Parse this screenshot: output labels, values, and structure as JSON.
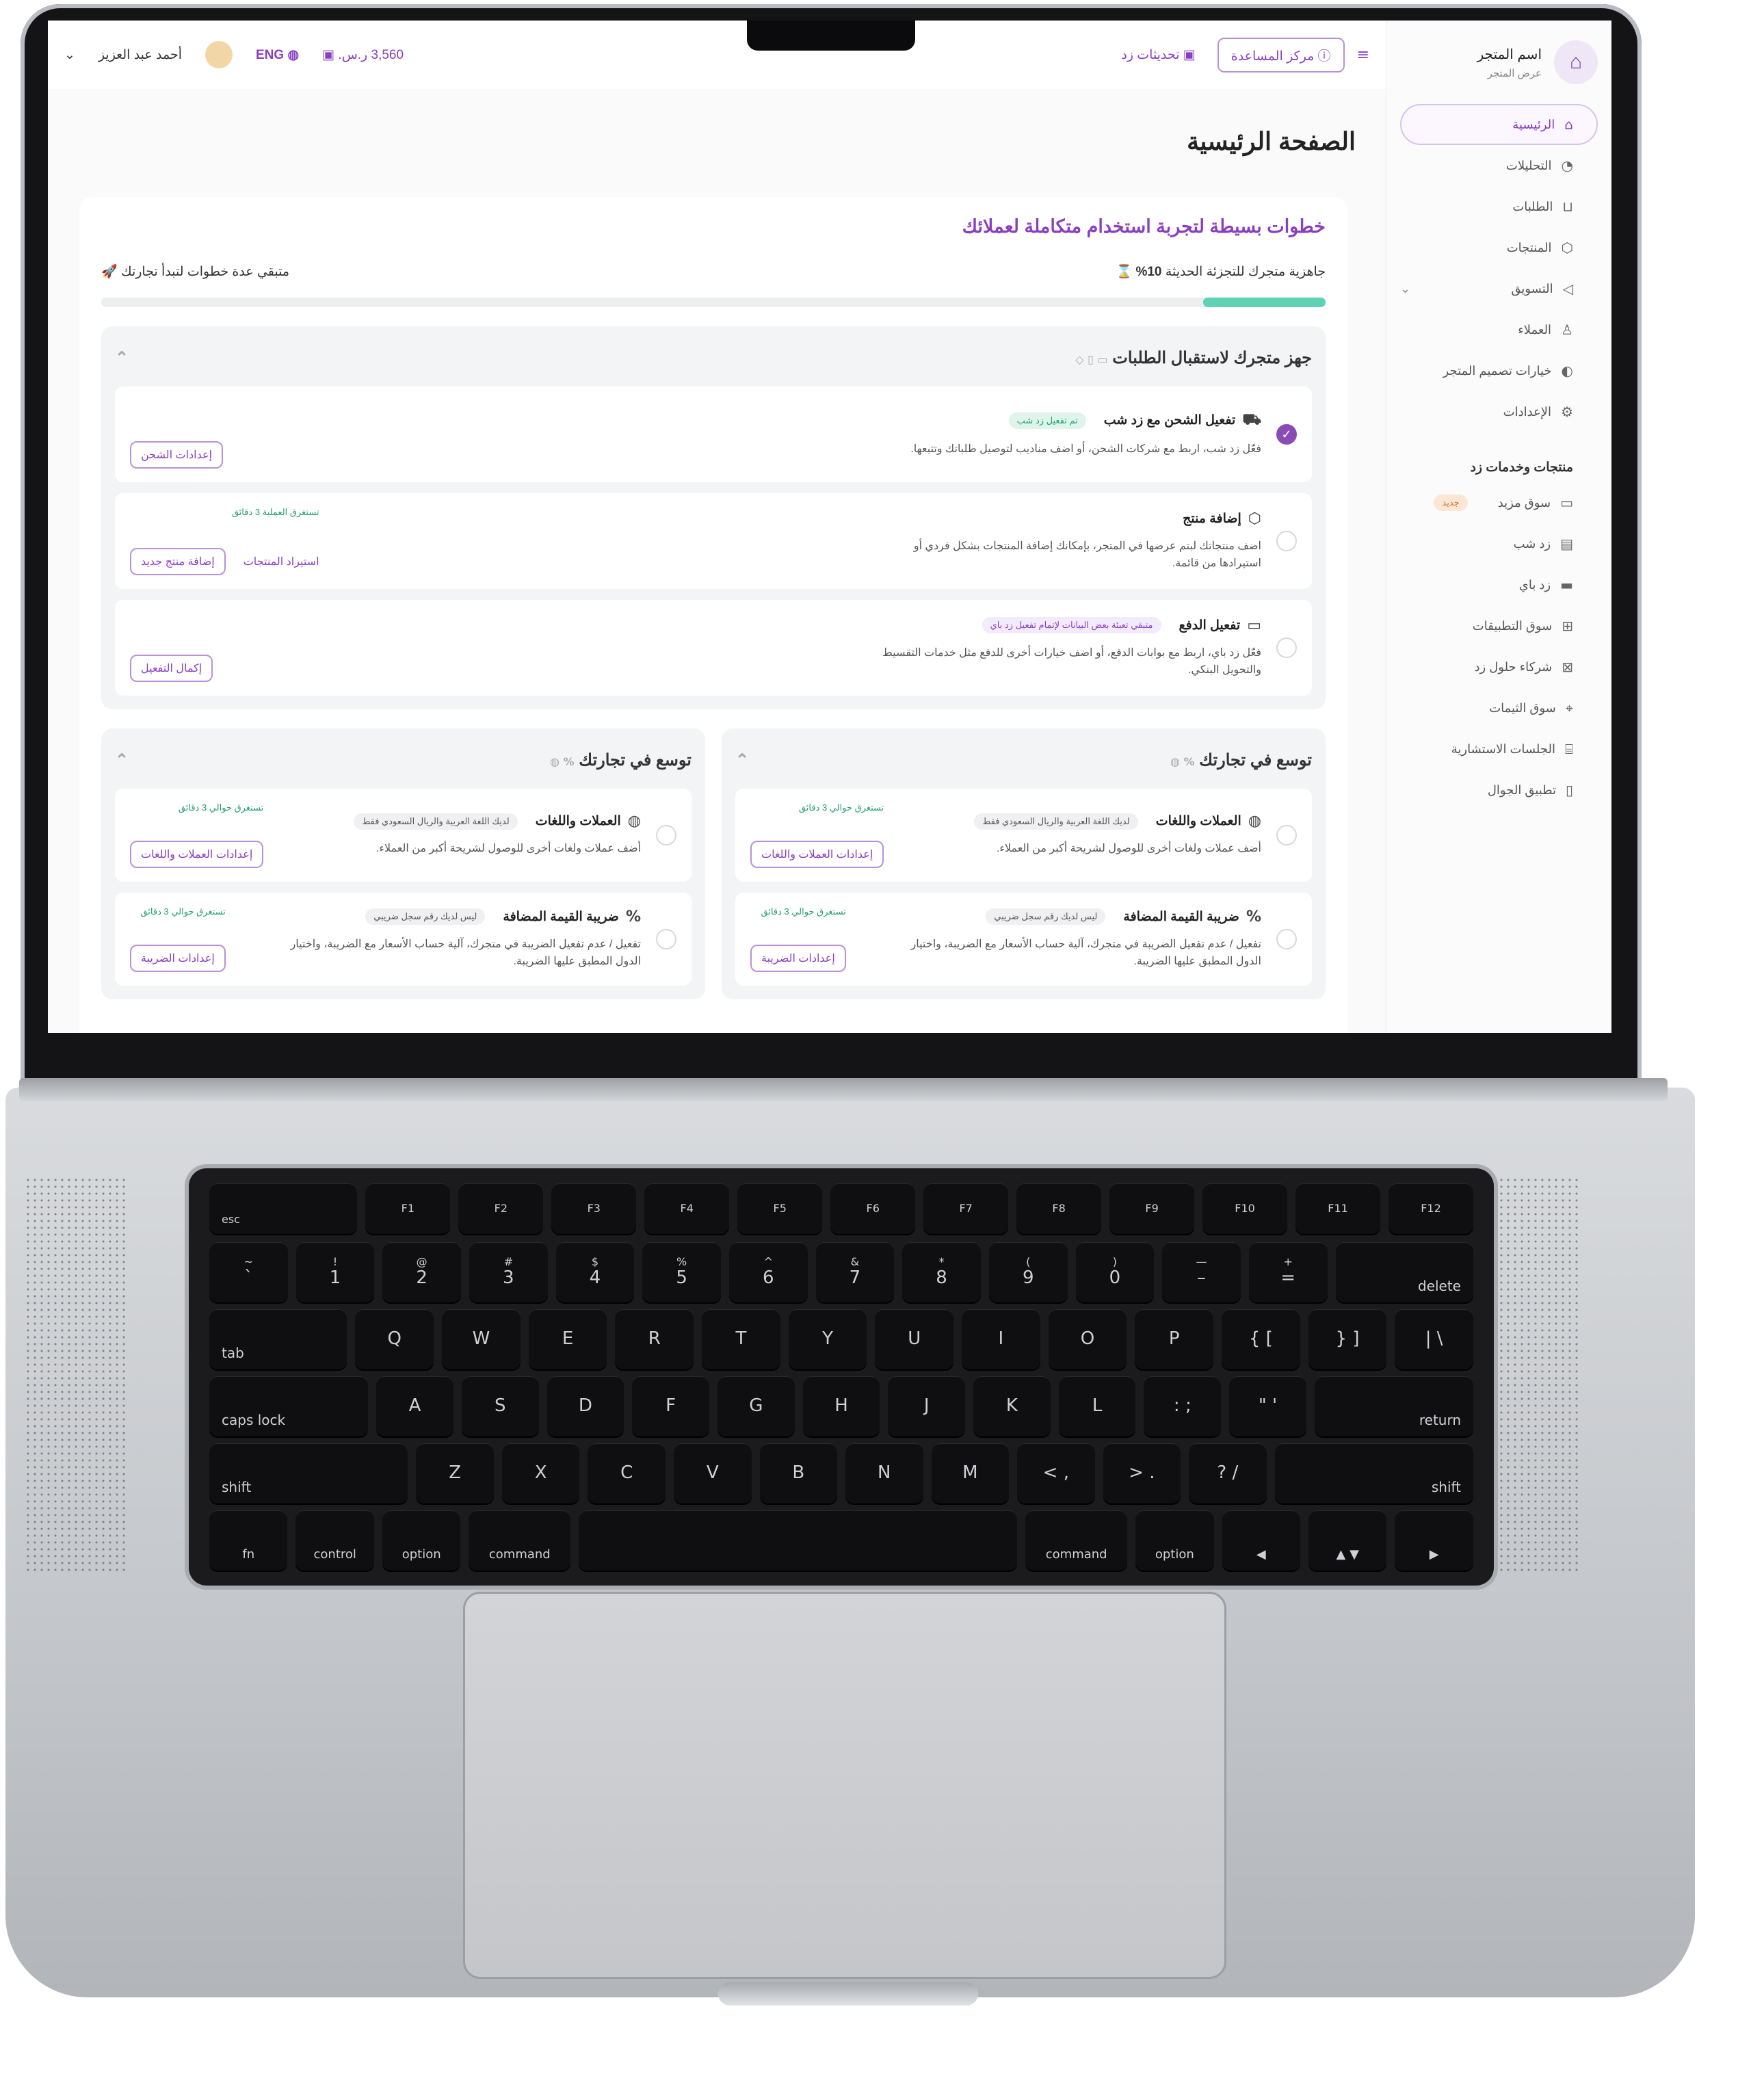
{
  "store": {
    "name": "اسم المتجر",
    "view_link": "عرض المتجر"
  },
  "topbar": {
    "help_center": "مركز المساعدة",
    "updates": "تحديثات زد",
    "balance": "3,560 ر.س.",
    "language": "ENG",
    "user_name": "أحمد عبد العزيز"
  },
  "sidebar": {
    "items": [
      {
        "label": "الرئيسية",
        "icon": "home-icon",
        "active": true
      },
      {
        "label": "التحليلات",
        "icon": "analytics-icon"
      },
      {
        "label": "الطلبات",
        "icon": "cart-icon"
      },
      {
        "label": "المنتجات",
        "icon": "box-icon"
      },
      {
        "label": "التسويق",
        "icon": "megaphone-icon"
      },
      {
        "label": "العملاء",
        "icon": "users-icon"
      },
      {
        "label": "خيارات تصميم المتجر",
        "icon": "palette-icon"
      },
      {
        "label": "الإعدادات",
        "icon": "gear-icon"
      }
    ],
    "section_title": "منتجات وخدمات زد",
    "services": [
      {
        "label": "سوق مزيد",
        "icon": "market-icon",
        "badge": "جديد"
      },
      {
        "label": "زد شب",
        "icon": "truck-icon"
      },
      {
        "label": "زد باي",
        "icon": "card-icon"
      },
      {
        "label": "سوق التطبيقات",
        "icon": "apps-icon"
      },
      {
        "label": "شركاء حلول زد",
        "icon": "partners-icon"
      },
      {
        "label": "سوق الثيمات",
        "icon": "brush-icon"
      },
      {
        "label": "الجلسات الاستشارية",
        "icon": "building-icon"
      },
      {
        "label": "تطبيق الجوال",
        "icon": "mobile-icon"
      }
    ]
  },
  "main": {
    "page_title": "الصفحة الرئيسية",
    "heading": "خطوات بسيطة لتجربة استخدام متكاملة لعملائك",
    "readiness_label": "جاهزية متجرك للتجزئة الحديثة",
    "readiness_value": "10%",
    "readiness_fraction": 0.1,
    "remaining": "متبقي عدة خطوات لتبدأ تجارتك",
    "card1": {
      "title": "جهز متجرك لاستقبال الطلبات",
      "items": [
        {
          "title": "تفعيل الشحن مع زد شب",
          "tag": "تم تفعيل زد شب",
          "desc": "فعّل زد شب، اربط مع شركات الشحن، أو اضف مناديب لتوصيل طلباتك وتتبعها.",
          "button": "إعدادات الشحن"
        },
        {
          "title": "إضافة منتج",
          "desc": "اضف منتجاتك لبتم عرضها في المتجر، بإمكانك إضافة المنتجات بشكل فردي أو استيرادها من قائمة.",
          "estimate": "تستغرق العملية 3 دقائق",
          "button": "إضافة منتج جديد",
          "link": "استيراد المنتجات"
        },
        {
          "title": "تفعيل الدفع",
          "tag": "متبقي تعبئة بعض البيانات لإتمام تفعيل زد باي",
          "desc": "فعّل زد باي، اربط مع بوابات الدفع، أو اضف خيارات أخرى للدفع مثل خدمات التقسيط والتحويل البنكي.",
          "button": "إكمال التفعيل"
        }
      ]
    },
    "card2": {
      "title": "توسع في تجارتك",
      "items": [
        {
          "title": "العملات واللغات",
          "tag": "لديك اللغة العربية والريال السعودي فقط",
          "estimate": "تستغرق حوالي 3 دقائق",
          "desc": "أضف عملات ولغات أخرى للوصول لشريحة أكبر من العملاء.",
          "button": "إعدادات العملات واللغات"
        },
        {
          "title": "ضريبة القيمة المضافة",
          "tag": "ليس لديك رقم سجل ضريبي",
          "estimate": "تستغرق حوالي 3 دقائق",
          "desc": "تفعيل / عدم تفعيل الضريبة في متجرك، آلية حساب الأسعار مع الضريبة، واختيار الدول المطبق عليها الضريبة.",
          "button": "إعدادات الضريبة"
        }
      ]
    },
    "card3": {
      "title": "توسع في تجارتك",
      "items": [
        {
          "title": "العملات واللغات",
          "tag": "لديك اللغة العربية والريال السعودي فقط",
          "estimate": "تستغرق حوالي 3 دقائق",
          "desc": "أضف عملات ولغات أخرى للوصول لشريحة أكبر من العملاء.",
          "button": "إعدادات العملات واللغات"
        },
        {
          "title": "ضريبة القيمة المضافة",
          "tag": "ليس لديك رقم سجل ضريبي",
          "estimate": "تستغرق حوالي 3 دقائق",
          "desc": "تفعيل / عدم تفعيل الضريبة في متجرك، آلية حساب الأسعار مع الضريبة، واختيار الدول المطبق عليها الضريبة.",
          "button": "إعدادات الضريبة"
        }
      ]
    }
  },
  "keyboard": {
    "fn_row": [
      "esc",
      "F1",
      "F2",
      "F3",
      "F4",
      "F5",
      "F6",
      "F7",
      "F8",
      "F9",
      "F10",
      "F11",
      "F12"
    ],
    "num_row": [
      [
        "~",
        "`"
      ],
      [
        "!",
        "1"
      ],
      [
        "@",
        "2"
      ],
      [
        "#",
        "3"
      ],
      [
        "$",
        "4"
      ],
      [
        "%",
        "5"
      ],
      [
        "^",
        "6"
      ],
      [
        "&",
        "7"
      ],
      [
        "*",
        "8"
      ],
      [
        "(",
        "9"
      ],
      [
        ")",
        "0"
      ],
      [
        "—",
        "–"
      ],
      [
        "+",
        "="
      ],
      [
        "",
        "delete"
      ]
    ],
    "q_row": [
      "tab",
      "Q",
      "W",
      "E",
      "R",
      "T",
      "Y",
      "U",
      "I",
      "O",
      "P",
      "{ [",
      "} ]",
      "| \\"
    ],
    "a_row": [
      "caps lock",
      "A",
      "S",
      "D",
      "F",
      "G",
      "H",
      "J",
      "K",
      "L",
      ": ;",
      "\" '",
      "return"
    ],
    "z_row": [
      "shift",
      "Z",
      "X",
      "C",
      "V",
      "B",
      "N",
      "M",
      "< ,",
      "> .",
      "? /",
      "shift"
    ],
    "bottom_row": [
      "fn",
      "control",
      "option",
      "command",
      "",
      "command",
      "option",
      "◀",
      "▲ ▼",
      "▶"
    ]
  }
}
